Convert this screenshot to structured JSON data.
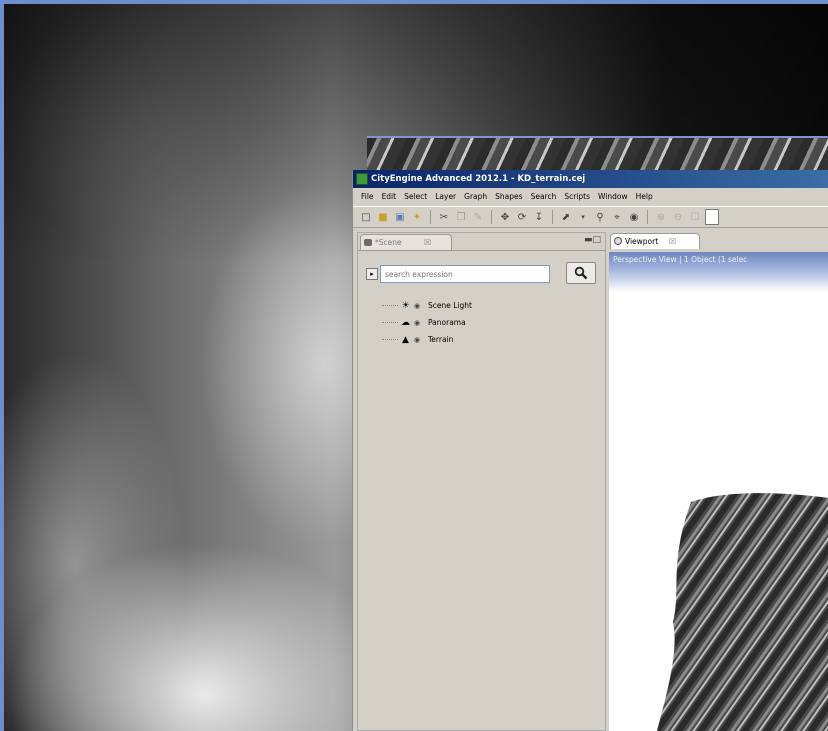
{
  "window": {
    "title": "CityEngine Advanced 2012.1 - KD_terrain.cej"
  },
  "menu": [
    "File",
    "Edit",
    "Select",
    "Layer",
    "Graph",
    "Shapes",
    "Search",
    "Scripts",
    "Window",
    "Help"
  ],
  "scene_panel": {
    "tab_label": "*Scene",
    "search_placeholder": "search expression",
    "items": [
      {
        "label": "Scene Light",
        "icon": "sun-icon"
      },
      {
        "label": "Panorama",
        "icon": "panorama-icon"
      },
      {
        "label": "Terrain",
        "icon": "terrain-icon"
      }
    ]
  },
  "viewport": {
    "tab_label": "Viewport",
    "header_text": "Perspective View  |  1 Object  (1 selec"
  }
}
